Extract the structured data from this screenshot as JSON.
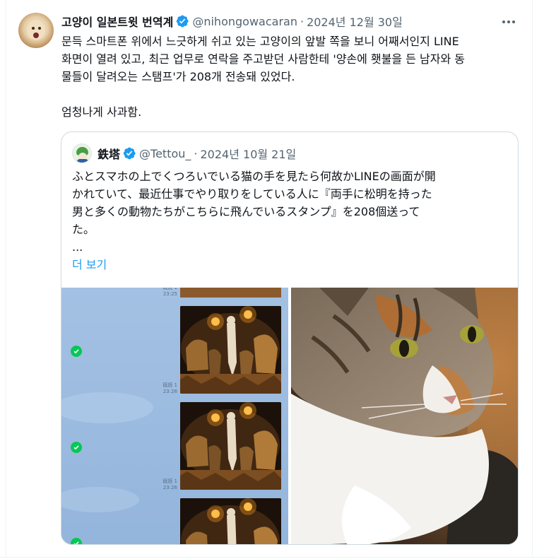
{
  "tweet": {
    "display_name": "고양이 일본트윗 번역계",
    "handle": "@nihongowacaran",
    "separator": "·",
    "date": "2024년 12월 30일",
    "verified_icon": "verified-badge-icon",
    "avatar_icon": "cat-avatar-icon",
    "body_lines": [
      "문득 스마트폰 위에서 느긋하게 쉬고 있는 고양이의 앞발 쪽을 보니 어째서인지 LINE",
      "화면이 열려 있고, 최근 업무로 연락을 주고받던 사람한테 '양손에 횃불을 든 남자와 동",
      "물들이 달려오는 스탬프'가 208개 전송돼 있었다."
    ],
    "body_last": "엄청나게 사과함."
  },
  "quoted": {
    "display_name": "鉄塔",
    "handle": "@Tettou_",
    "separator": "·",
    "date": "2024년 10월 21일",
    "lines": [
      "ふとスマホの上でくつろいでいる猫の手を見たら何故かLINEの画面が開",
      "かれていて、最近仕事でやり取りをしている人に『両手に松明を持った",
      "男と多くの動物たちがこちらに飛んでいるスタンプ』を208個送って",
      "た。"
    ],
    "ellipsis": "...",
    "show_more": "더 보기",
    "media": {
      "left_image": "line-chat-screenshot",
      "right_image": "tabby-cat-photo",
      "read_label": "既読 1",
      "times": [
        "23:25",
        "23:26",
        "23:26"
      ]
    }
  },
  "colors": {
    "accent": "#1d9bf0",
    "secondary_text": "#536471",
    "line_green": "#06c755",
    "line_chat_bg": "#9cbde1"
  }
}
